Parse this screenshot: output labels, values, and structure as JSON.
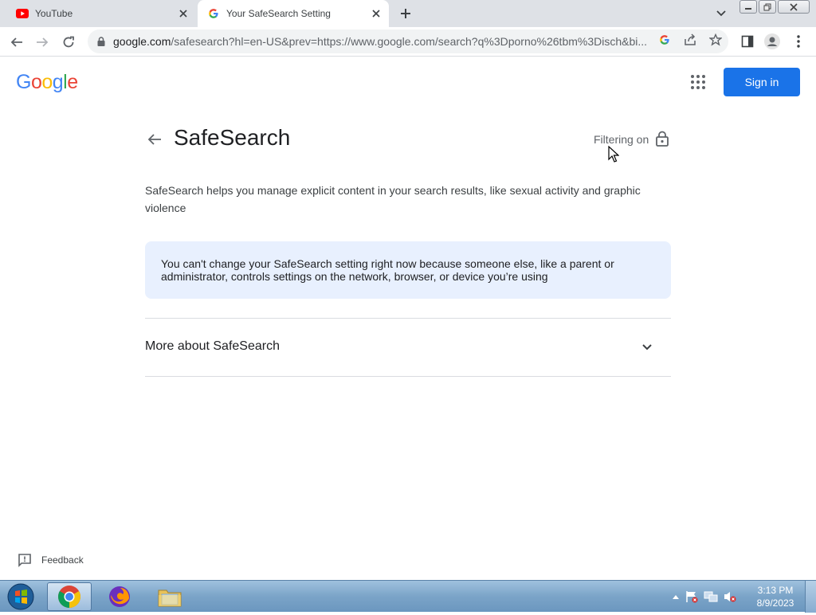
{
  "tabs": [
    {
      "title": "YouTube",
      "active": false
    },
    {
      "title": "Your SafeSearch Setting",
      "active": true
    }
  ],
  "toolbar": {
    "url_host": "google.com",
    "url_path": "/safesearch?hl=en-US&prev=https://www.google.com/search?q%3Dporno%26tbm%3Disch&bi..."
  },
  "header": {
    "logo": "Google",
    "signin_label": "Sign in"
  },
  "main": {
    "title": "SafeSearch",
    "filtering_label": "Filtering on",
    "description": "SafeSearch helps you manage explicit content in your search results, like sexual activity and graphic violence",
    "notice": "You can't change your SafeSearch setting right now because someone else, like a parent or administrator, controls settings on the network, browser, or device you’re using",
    "more_label": "More about SafeSearch"
  },
  "footer": {
    "feedback_label": "Feedback"
  },
  "taskbar": {
    "time": "3:13 PM",
    "date": "8/9/2023"
  },
  "colors": {
    "accent": "#1a73e8",
    "notice_bg": "#e8f0fe",
    "youtube_red": "#ff0000"
  },
  "icons": [
    "youtube-icon",
    "google-g-icon",
    "close-icon",
    "plus-icon",
    "chevron-down-icon",
    "back-arrow-icon",
    "forward-arrow-icon",
    "reload-icon",
    "lock-icon",
    "share-icon",
    "star-icon",
    "sidepanel-icon",
    "profile-icon",
    "more-vert-icon",
    "apps-grid-icon",
    "feedback-icon"
  ]
}
